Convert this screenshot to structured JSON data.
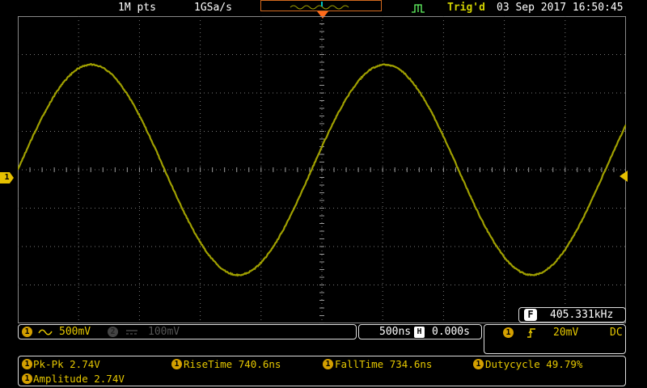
{
  "top": {
    "record_length": "1M pts",
    "sample_rate": "1GSa/s",
    "trigger_status": "Trig'd",
    "datetime": "03 Sep 2017 16:50:45"
  },
  "trace": {
    "color": "#a0a000",
    "cycles_visible": 2.07,
    "amplitude_divs": 2.74
  },
  "freq_readout": {
    "label": "F",
    "value": "405.331kHz"
  },
  "channels": {
    "ch1": {
      "badge": "1",
      "coupling_icon": "ac-wave-icon",
      "scale": "500mV"
    },
    "ch2": {
      "badge": "2",
      "coupling_icon": "dc-lines-icon",
      "scale": "100mV"
    }
  },
  "timebase": {
    "scale": "500ns",
    "position_badge": "H",
    "position": "0.000s"
  },
  "trigger": {
    "source_badge": "1",
    "edge_icon": "rising-edge-icon",
    "level": "20mV",
    "coupling": "DC"
  },
  "measurements": {
    "pkpk": "Pk-Pk 2.74V",
    "rise": "RiseTime 740.6ns",
    "fall": "FallTime 734.6ns",
    "duty": "Dutycycle 49.79%",
    "amplitude": "Amplitude 2.74V"
  },
  "markers": {
    "ch1_ground": "1"
  }
}
